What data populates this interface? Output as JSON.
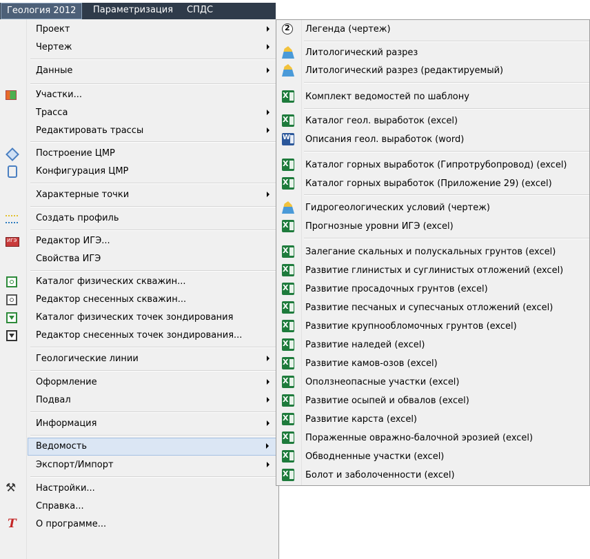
{
  "menubar": {
    "items": [
      {
        "label": "Геология 2012",
        "active": true
      },
      {
        "label": "Параметризация",
        "active": false
      },
      {
        "label": "СПДС",
        "active": false
      }
    ]
  },
  "main_menu": {
    "items": [
      {
        "label": "Проект",
        "has_submenu": true,
        "icon": ""
      },
      {
        "label": "Чертеж",
        "has_submenu": true,
        "icon": ""
      },
      {
        "label": "Данные",
        "has_submenu": true,
        "icon": ""
      },
      {
        "label": "Участки...",
        "has_submenu": false,
        "icon": "table-icon"
      },
      {
        "label": "Трасса",
        "has_submenu": true,
        "icon": ""
      },
      {
        "label": "Редактировать трассы",
        "has_submenu": true,
        "icon": ""
      },
      {
        "label": "Построение ЦМР",
        "has_submenu": false,
        "icon": "dem-build-icon"
      },
      {
        "label": "Конфигурация ЦМР",
        "has_submenu": false,
        "icon": "dem-config-icon"
      },
      {
        "label": "Характерные точки",
        "has_submenu": true,
        "icon": ""
      },
      {
        "label": "Создать профиль",
        "has_submenu": false,
        "icon": "profile-icon"
      },
      {
        "label": "Редактор ИГЭ...",
        "has_submenu": false,
        "icon": "ige-icon"
      },
      {
        "label": "Свойства ИГЭ",
        "has_submenu": false,
        "icon": ""
      },
      {
        "label": "Каталог физических скважин...",
        "has_submenu": false,
        "icon": "well-icon"
      },
      {
        "label": "Редактор снесенных скважин...",
        "has_submenu": false,
        "icon": "well-gray-icon"
      },
      {
        "label": "Каталог физических точек зондирования",
        "has_submenu": false,
        "icon": "sounding-icon"
      },
      {
        "label": "Редактор снесенных точек зондирования...",
        "has_submenu": false,
        "icon": "sounding-dark-icon"
      },
      {
        "label": "Геологические линии",
        "has_submenu": true,
        "icon": ""
      },
      {
        "label": "Оформление",
        "has_submenu": true,
        "icon": ""
      },
      {
        "label": "Подвал",
        "has_submenu": true,
        "icon": ""
      },
      {
        "label": "Информация",
        "has_submenu": true,
        "icon": ""
      },
      {
        "label": "Ведомость",
        "has_submenu": true,
        "icon": "",
        "highlighted": true
      },
      {
        "label": "Экспорт/Импорт",
        "has_submenu": true,
        "icon": ""
      },
      {
        "label": "Настройки...",
        "has_submenu": false,
        "icon": "tools-icon"
      },
      {
        "label": "Справка...",
        "has_submenu": false,
        "icon": ""
      },
      {
        "label": "О программе...",
        "has_submenu": false,
        "icon": "about-icon"
      }
    ]
  },
  "submenu": {
    "items": [
      {
        "label": "Легенда (чертеж)",
        "icon": "legend-icon"
      },
      {
        "label": "Литологический разрез",
        "icon": "section-icon"
      },
      {
        "label": "Литологический разрез (редактируемый)",
        "icon": "section-icon"
      },
      {
        "label": "Комплект ведомостей по шаблону",
        "icon": "excel-icon"
      },
      {
        "label": "Каталог геол. выработок (excel)",
        "icon": "excel-icon"
      },
      {
        "label": "Описания геол. выработок (word)",
        "icon": "word-icon"
      },
      {
        "label": "Каталог горных выработок (Гипротрубопровод) (excel)",
        "icon": "excel-icon"
      },
      {
        "label": "Каталог горных выработок (Приложение 29) (excel)",
        "icon": "excel-icon"
      },
      {
        "label": "Гидрогеологических условий (чертеж)",
        "icon": "section-icon"
      },
      {
        "label": "Прогнозные уровни ИГЭ (excel)",
        "icon": "excel-icon"
      },
      {
        "label": "Залегание скальных и полускальных грунтов (excel)",
        "icon": "excel-icon"
      },
      {
        "label": "Развитие глинистых и суглинистых отложений (excel)",
        "icon": "excel-icon"
      },
      {
        "label": "Развитие просадочных грунтов (excel)",
        "icon": "excel-icon"
      },
      {
        "label": "Развитие песчаных и супесчаных отложений (excel)",
        "icon": "excel-icon"
      },
      {
        "label": "Развитие крупнообломочных грунтов (excel)",
        "icon": "excel-icon"
      },
      {
        "label": "Развитие наледей (excel)",
        "icon": "excel-icon"
      },
      {
        "label": "Развитие камов-озов (excel)",
        "icon": "excel-icon"
      },
      {
        "label": "Оползнеопасные участки (excel)",
        "icon": "excel-icon"
      },
      {
        "label": "Развитие осыпей и обвалов (excel)",
        "icon": "excel-icon"
      },
      {
        "label": "Развитие карста (excel)",
        "icon": "excel-icon"
      },
      {
        "label": "Пораженные овражно-балочной эрозией (excel)",
        "icon": "excel-icon"
      },
      {
        "label": "Обводненные участки (excel)",
        "icon": "excel-icon"
      },
      {
        "label": "Болот и заболоченности (excel)",
        "icon": "excel-icon"
      }
    ]
  }
}
